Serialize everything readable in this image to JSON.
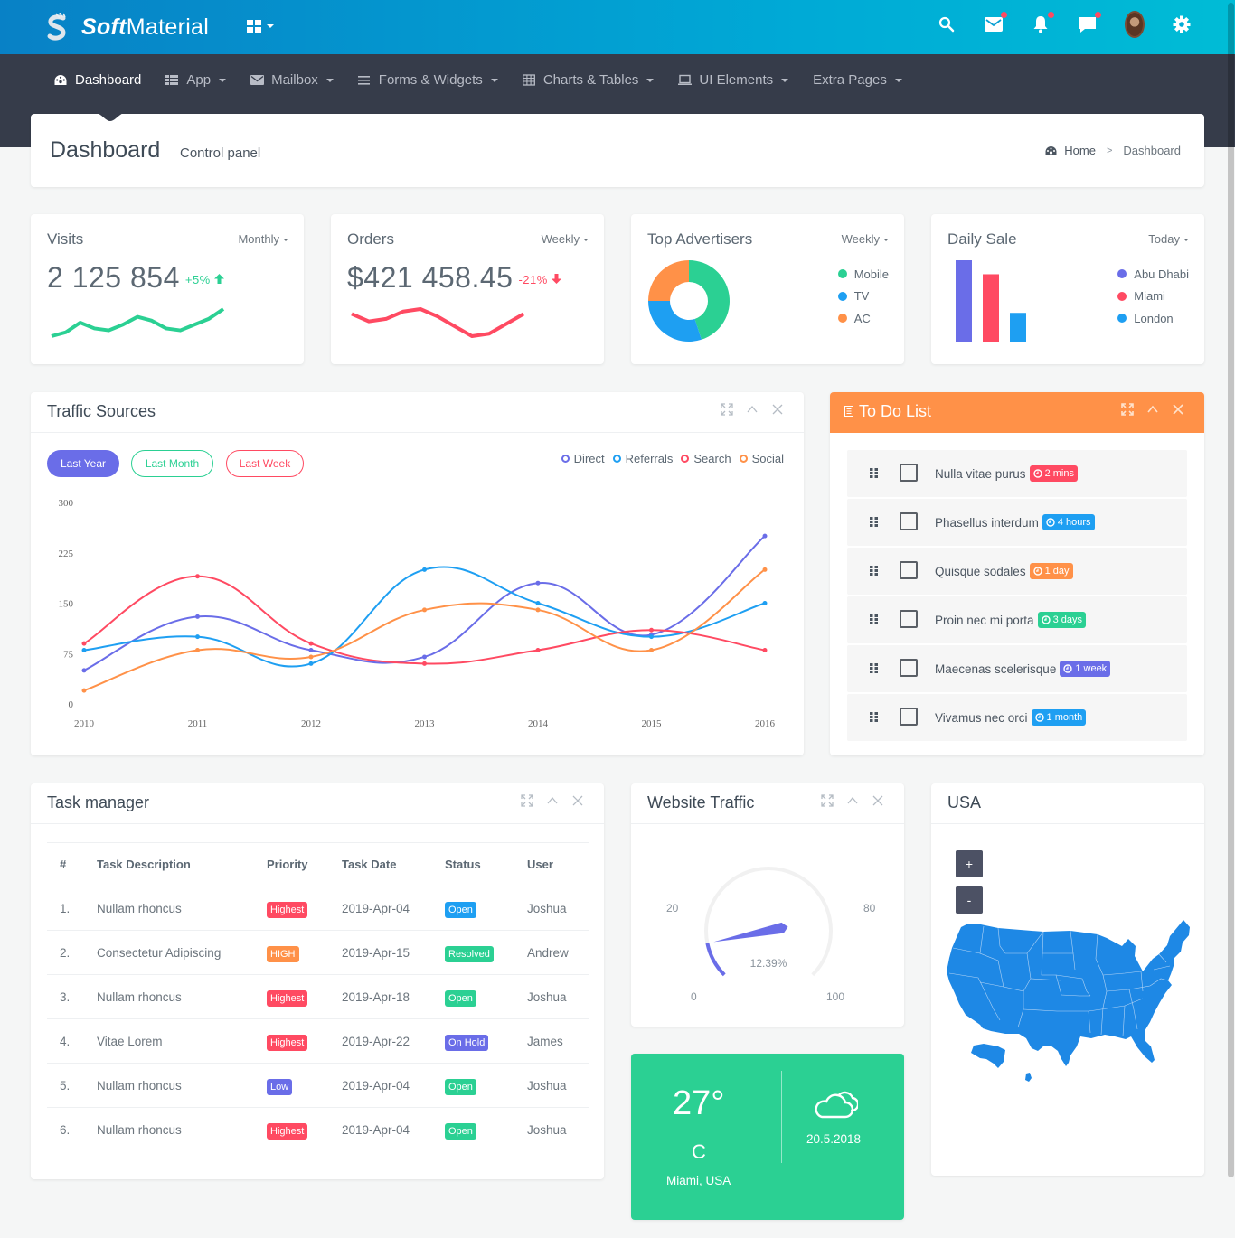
{
  "app": {
    "brand_bold": "Soft",
    "brand_light": "Material"
  },
  "topbar": {
    "icons": [
      "search-icon",
      "mail-icon",
      "bell-icon",
      "chat-icon",
      "avatar",
      "gear-icon"
    ],
    "notification_dot_color": "#ff4a62"
  },
  "nav": {
    "items": [
      {
        "label": "Dashboard",
        "icon": "dashboard-icon",
        "active": true,
        "dropdown": false
      },
      {
        "label": "App",
        "icon": "apps-icon",
        "dropdown": true
      },
      {
        "label": "Mailbox",
        "icon": "mail-icon",
        "dropdown": true
      },
      {
        "label": "Forms & Widgets",
        "icon": "list-icon",
        "dropdown": true
      },
      {
        "label": "Charts & Tables",
        "icon": "table-icon",
        "dropdown": true
      },
      {
        "label": "UI Elements",
        "icon": "laptop-icon",
        "dropdown": true
      },
      {
        "label": "Extra Pages",
        "icon": "",
        "dropdown": true
      }
    ]
  },
  "page": {
    "title": "Dashboard",
    "subtitle": "Control panel",
    "breadcrumb": {
      "home": "Home",
      "separator": ">",
      "current": "Dashboard"
    }
  },
  "stats": {
    "visits": {
      "title": "Visits",
      "period": "Monthly",
      "value": "2 125 854",
      "delta": "+5%",
      "delta_dir": "up",
      "color": "#2bd093",
      "spark": [
        2,
        4,
        9,
        6,
        5,
        8,
        12,
        10,
        6,
        5,
        8,
        11,
        16
      ]
    },
    "orders": {
      "title": "Orders",
      "period": "Weekly",
      "value": "$421 458.45",
      "delta": "-21%",
      "delta_dir": "down",
      "color": "#ff4a62",
      "spark": [
        10,
        7,
        8,
        11,
        12,
        9,
        5,
        1,
        2,
        6,
        10
      ]
    },
    "advertisers": {
      "title": "Top Advertisers",
      "period": "Weekly",
      "legend": [
        {
          "label": "Mobile",
          "color": "#2bd093",
          "value": 45
        },
        {
          "label": "TV",
          "color": "#1e9ff2",
          "value": 30
        },
        {
          "label": "AC",
          "color": "#ff9148",
          "value": 25
        }
      ]
    },
    "daily": {
      "title": "Daily Sale",
      "period": "Today",
      "legend": [
        {
          "label": "Abu Dhabi",
          "color": "#6a6de8",
          "value": 100
        },
        {
          "label": "Miami",
          "color": "#ff4a62",
          "value": 83
        },
        {
          "label": "London",
          "color": "#1e9ff2",
          "value": 36
        }
      ]
    }
  },
  "traffic": {
    "title": "Traffic Sources",
    "filters": [
      {
        "label": "Last Year",
        "active": true,
        "color": "#6a6de8"
      },
      {
        "label": "Last Month",
        "color": "#2bd093"
      },
      {
        "label": "Last Week",
        "color": "#ff4a62"
      }
    ]
  },
  "chart_data": {
    "type": "line",
    "title": "Traffic Sources",
    "xlabel": "",
    "ylabel": "",
    "categories": [
      "2010",
      "2011",
      "2012",
      "2013",
      "2014",
      "2015",
      "2016"
    ],
    "yticks": [
      "0",
      "75",
      "150",
      "225",
      "300"
    ],
    "ylim": [
      0,
      300
    ],
    "grid": false,
    "legend_position": "top-right",
    "series": [
      {
        "name": "Direct",
        "color": "#6a6de8",
        "values": [
          50,
          130,
          80,
          70,
          180,
          103,
          250
        ]
      },
      {
        "name": "Referrals",
        "color": "#1e9ff2",
        "values": [
          80,
          100,
          60,
          200,
          150,
          100,
          150
        ]
      },
      {
        "name": "Search",
        "color": "#ff4a62",
        "values": [
          90,
          190,
          90,
          60,
          80,
          110,
          80
        ]
      },
      {
        "name": "Social",
        "color": "#ff9148",
        "values": [
          20,
          80,
          70,
          140,
          140,
          80,
          200
        ]
      }
    ]
  },
  "todo": {
    "title": "To Do List",
    "items": [
      {
        "text": "Nulla vitae purus",
        "tag": "2 mins",
        "color": "#ff4a62"
      },
      {
        "text": "Phasellus interdum",
        "tag": "4 hours",
        "color": "#1e9ff2"
      },
      {
        "text": "Quisque sodales",
        "tag": "1 day",
        "color": "#ff9148"
      },
      {
        "text": "Proin nec mi porta",
        "tag": "3 days",
        "color": "#2bd093"
      },
      {
        "text": "Maecenas scelerisque",
        "tag": "1 week",
        "color": "#6a6de8"
      },
      {
        "text": "Vivamus nec orci",
        "tag": "1 month",
        "color": "#1e9ff2"
      }
    ]
  },
  "tasks": {
    "title": "Task manager",
    "columns": [
      "#",
      "Task Description",
      "Priority",
      "Task Date",
      "Status",
      "User"
    ],
    "rows": [
      {
        "n": "1.",
        "desc": "Nullam rhoncus",
        "priority": "Highest",
        "pcolor": "#ff4a62",
        "date": "2019-Apr-04",
        "status": "Open",
        "scolor": "#1e9ff2",
        "user": "Joshua"
      },
      {
        "n": "2.",
        "desc": "Consectetur Adipiscing",
        "priority": "HIGH",
        "pcolor": "#ff9148",
        "date": "2019-Apr-15",
        "status": "Resolved",
        "scolor": "#2bd093",
        "user": "Andrew"
      },
      {
        "n": "3.",
        "desc": "Nullam rhoncus",
        "priority": "Highest",
        "pcolor": "#ff4a62",
        "date": "2019-Apr-18",
        "status": "Open",
        "scolor": "#2bd093",
        "user": "Joshua"
      },
      {
        "n": "4.",
        "desc": "Vitae Lorem",
        "priority": "Highest",
        "pcolor": "#ff4a62",
        "date": "2019-Apr-22",
        "status": "On Hold",
        "scolor": "#6a6de8",
        "user": "James"
      },
      {
        "n": "5.",
        "desc": "Nullam rhoncus",
        "priority": "Low",
        "pcolor": "#6a6de8",
        "date": "2019-Apr-04",
        "status": "Open",
        "scolor": "#2bd093",
        "user": "Joshua"
      },
      {
        "n": "6.",
        "desc": "Nullam rhoncus",
        "priority": "Highest",
        "pcolor": "#ff4a62",
        "date": "2019-Apr-04",
        "status": "Open",
        "scolor": "#2bd093",
        "user": "Joshua"
      }
    ]
  },
  "website_traffic": {
    "title": "Website Traffic",
    "value_label": "12.39%",
    "value": 12.39,
    "scale": {
      "min": "0",
      "low": "20",
      "high": "80",
      "max": "100"
    },
    "color": "#6a6de8"
  },
  "weather": {
    "temp": "27°",
    "unit": "C",
    "city": "Miami, USA",
    "date": "20.5.2018",
    "icon": "cloud-icon"
  },
  "map": {
    "title": "USA",
    "zoom_in": "+",
    "zoom_out": "-",
    "fill": "#1e88e5"
  }
}
